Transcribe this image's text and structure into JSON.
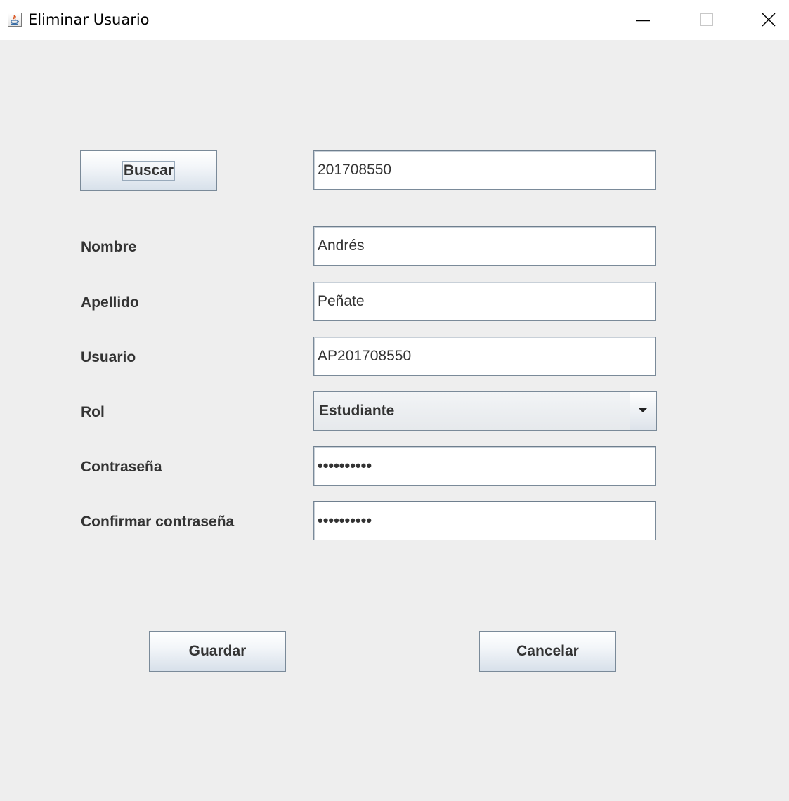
{
  "window": {
    "title": "Eliminar Usuario",
    "app_icon": "java-icon",
    "controls": [
      "minimize-icon",
      "maximize-icon",
      "close-icon"
    ]
  },
  "search": {
    "button_label": "Buscar",
    "value": "201708550"
  },
  "form": {
    "nombre": {
      "label": "Nombre",
      "value": "Andrés"
    },
    "apellido": {
      "label": "Apellido",
      "value": "Peñate"
    },
    "usuario": {
      "label": "Usuario",
      "value": "AP201708550"
    },
    "rol": {
      "label": "Rol",
      "selected": "Estudiante"
    },
    "contrasena": {
      "label": "Contraseña",
      "masked_value": "••••••••••"
    },
    "confirmar": {
      "label": "Confirmar contraseña",
      "masked_value": "••••••••••"
    }
  },
  "actions": {
    "save_label": "Guardar",
    "cancel_label": "Cancelar"
  }
}
